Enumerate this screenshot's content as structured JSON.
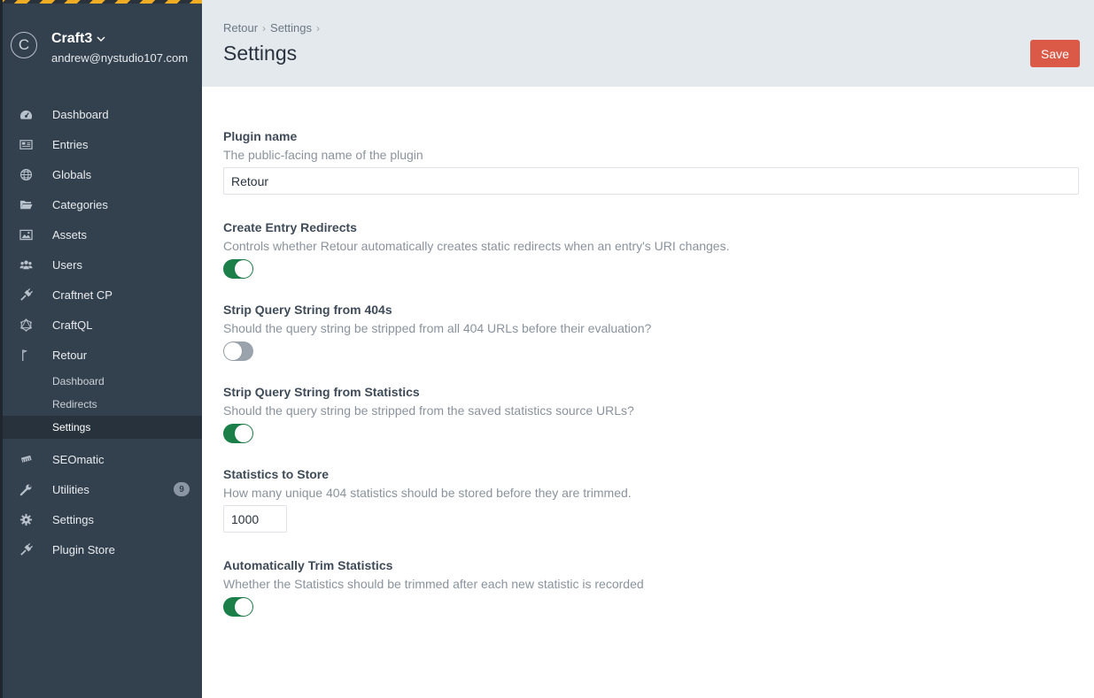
{
  "colors": {
    "sidebar_bg": "#33404d",
    "header_bg": "#e4e9ee",
    "accent_save": "#da5a47",
    "toggle_on": "#1a7f48",
    "toggle_off": "#9aa2ab"
  },
  "site": {
    "logo_letter": "C",
    "name": "Craft3",
    "user_email": "andrew@nystudio107.com"
  },
  "sidebar": {
    "items": [
      {
        "label": "Dashboard",
        "icon": "gauge-icon"
      },
      {
        "label": "Entries",
        "icon": "newspaper-icon"
      },
      {
        "label": "Globals",
        "icon": "globe-icon"
      },
      {
        "label": "Categories",
        "icon": "folder-icon"
      },
      {
        "label": "Assets",
        "icon": "image-icon"
      },
      {
        "label": "Users",
        "icon": "users-icon"
      },
      {
        "label": "Craftnet CP",
        "icon": "plug-icon"
      },
      {
        "label": "CraftQL",
        "icon": "graphql-icon"
      },
      {
        "label": "Retour",
        "icon": "flag-icon"
      }
    ],
    "retour_subitems": [
      {
        "label": "Dashboard"
      },
      {
        "label": "Redirects"
      },
      {
        "label": "Settings",
        "active": true
      }
    ],
    "bottom_items": [
      {
        "label": "SEOmatic",
        "icon": "seomatic-icon"
      },
      {
        "label": "Utilities",
        "icon": "wrench-icon",
        "badge": "9"
      },
      {
        "label": "Settings",
        "icon": "gear-icon"
      },
      {
        "label": "Plugin Store",
        "icon": "plug-icon"
      }
    ]
  },
  "header": {
    "breadcrumbs": [
      "Retour",
      "Settings"
    ],
    "title": "Settings",
    "save_label": "Save"
  },
  "form": {
    "plugin_name": {
      "label": "Plugin name",
      "help": "The public-facing name of the plugin",
      "value": "Retour"
    },
    "create_entry_redirects": {
      "label": "Create Entry Redirects",
      "help": "Controls whether Retour automatically creates static redirects when an entry's URI changes.",
      "on": true
    },
    "strip_query_404": {
      "label": "Strip Query String from 404s",
      "help": "Should the query string be stripped from all 404 URLs before their evaluation?",
      "on": false
    },
    "strip_query_stats": {
      "label": "Strip Query String from Statistics",
      "help": "Should the query string be stripped from the saved statistics source URLs?",
      "on": true
    },
    "stats_to_store": {
      "label": "Statistics to Store",
      "help": "How many unique 404 statistics should be stored before they are trimmed.",
      "value": "1000"
    },
    "auto_trim": {
      "label": "Automatically Trim Statistics",
      "help": "Whether the Statistics should be trimmed after each new statistic is recorded",
      "on": true
    }
  }
}
